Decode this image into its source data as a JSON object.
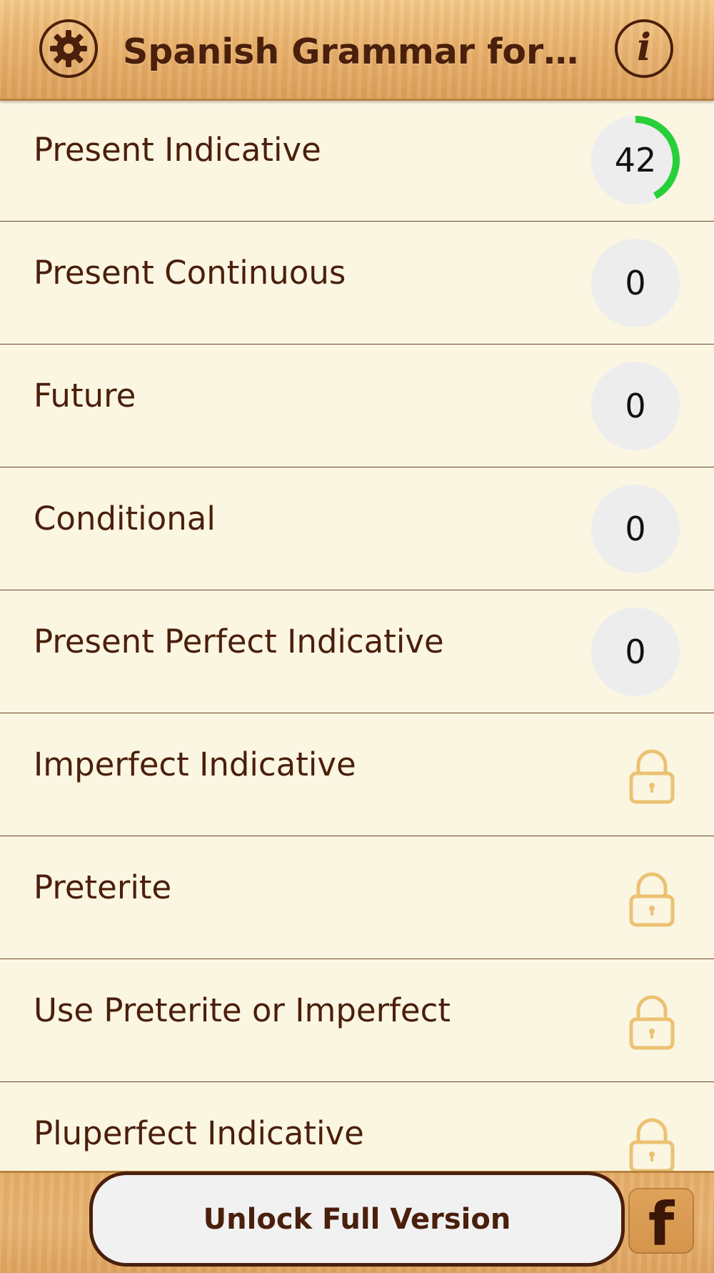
{
  "header": {
    "title": "Spanish Grammar for…",
    "settings_icon": "gear-icon",
    "info_icon": "info-icon",
    "info_glyph": "i"
  },
  "lessons": [
    {
      "label": "Present Indicative",
      "status": "progress",
      "count": "42",
      "progress_percent": 42
    },
    {
      "label": "Present Continuous",
      "status": "progress",
      "count": "0",
      "progress_percent": 0
    },
    {
      "label": "Future",
      "status": "progress",
      "count": "0",
      "progress_percent": 0
    },
    {
      "label": "Conditional",
      "status": "progress",
      "count": "0",
      "progress_percent": 0
    },
    {
      "label": "Present Perfect Indicative",
      "status": "progress",
      "count": "0",
      "progress_percent": 0
    },
    {
      "label": "Imperfect Indicative",
      "status": "locked",
      "icon": "lock-icon"
    },
    {
      "label": "Preterite",
      "status": "locked",
      "icon": "lock-icon"
    },
    {
      "label": "Use Preterite or Imperfect",
      "status": "locked",
      "icon": "lock-icon"
    },
    {
      "label": "Pluperfect Indicative",
      "status": "locked",
      "icon": "lock-icon"
    }
  ],
  "footer": {
    "unlock_label": "Unlock Full Version",
    "facebook_icon": "facebook-icon",
    "facebook_glyph": "f"
  },
  "colors": {
    "text_brown": "#4a1f0b",
    "progress_green": "#27d039",
    "lock_gold": "#ebc273",
    "badge_gray": "#ededed",
    "background": "#fbf6e2"
  }
}
